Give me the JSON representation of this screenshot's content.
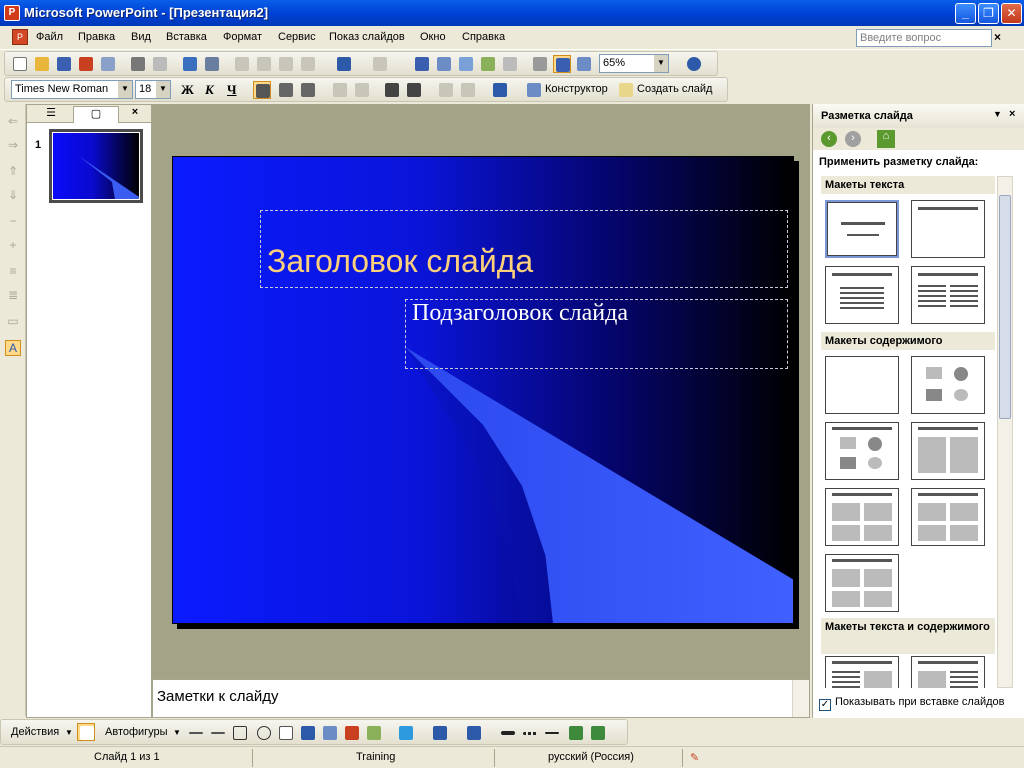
{
  "window": {
    "title": "Microsoft PowerPoint - [Презентация2]",
    "minimize_label": "_",
    "maximize_label": "❐",
    "close_label": "✕"
  },
  "menu": {
    "items": [
      "Файл",
      "Правка",
      "Вид",
      "Вставка",
      "Формат",
      "Сервис",
      "Показ слайдов",
      "Окно",
      "Справка"
    ],
    "ask_placeholder": "Введите вопрос",
    "close_label": "×"
  },
  "standard_toolbar": {
    "zoom_value": "65%"
  },
  "formatting_toolbar": {
    "font_name": "Times New Roman",
    "font_size": "18",
    "bold_label": "Ж",
    "italic_label": "К",
    "underline_label": "Ч",
    "designer_label": "Конструктор",
    "new_slide_label": "Создать слайд"
  },
  "slides_pane": {
    "tab_outline_icon": "outline-icon",
    "tab_slides_icon": "slides-icon",
    "close_label": "×",
    "thumbnail_number": "1"
  },
  "slide": {
    "title_text": "Заголовок слайда",
    "subtitle_text": "Подзаголовок слайда"
  },
  "notes": {
    "placeholder": "Заметки к слайду"
  },
  "task_pane": {
    "title": "Разметка слайда",
    "apply_label": "Применить разметку слайда:",
    "sections": {
      "text_layouts": "Макеты текста",
      "content_layouts": "Макеты содержимого",
      "text_content_layouts": "Макеты текста и содержимого"
    },
    "show_on_insert_label": "Показывать при вставке слайдов",
    "show_on_insert_checked": true
  },
  "drawing_toolbar": {
    "actions_label": "Действия",
    "autoshapes_label": "Автофигуры"
  },
  "status_bar": {
    "slide_info": "Слайд 1 из 1",
    "design": "Training",
    "language": "русский (Россия)"
  },
  "colors": {
    "title_text": "#ffd07a",
    "slide_bg_left": "#0a1bff",
    "slide_bg_right": "#000000",
    "titlebar": "#0042d6"
  }
}
